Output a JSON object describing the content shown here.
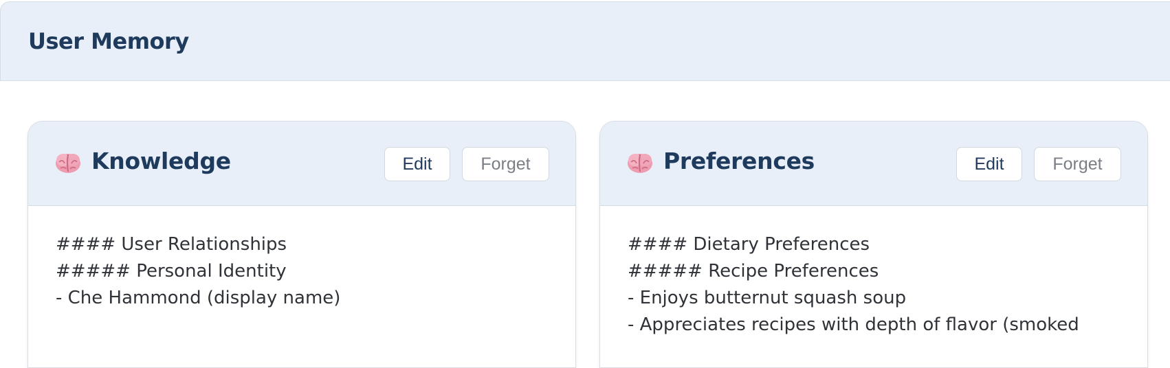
{
  "panel": {
    "title": "User Memory"
  },
  "cards": [
    {
      "icon": "brain-icon",
      "title": "Knowledge",
      "edit_label": "Edit",
      "forget_label": "Forget",
      "lines": [
        "#### User Relationships",
        "##### Personal Identity",
        "- Che Hammond (display name)"
      ]
    },
    {
      "icon": "brain-icon",
      "title": "Preferences",
      "edit_label": "Edit",
      "forget_label": "Forget",
      "lines": [
        "#### Dietary Preferences",
        "##### Recipe Preferences",
        "- Enjoys butternut squash soup",
        "- Appreciates recipes with depth of flavor (smoked"
      ]
    }
  ],
  "colors": {
    "header_bg": "#e8eff8",
    "title": "#1e3a5c",
    "body_text": "#2f3338",
    "muted_button": "#7a7f86"
  }
}
